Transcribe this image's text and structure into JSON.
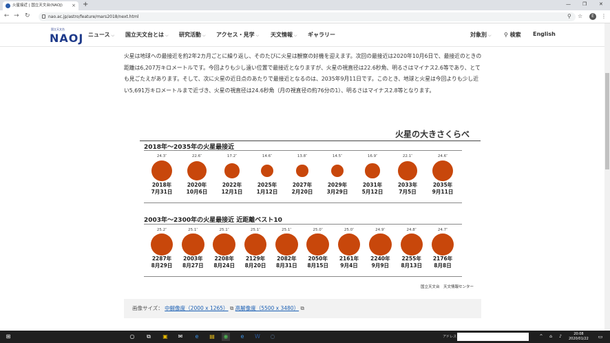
{
  "browser": {
    "tab_title": "火星接近 | 国立天文台(NAOJ)",
    "new_tab": "+",
    "url": "nao.ac.jp/astro/feature/mars2018/next.html",
    "avatar": "E",
    "window_min": "—",
    "window_max": "❐",
    "window_close": "✕"
  },
  "header": {
    "logo_small": "国立天文台",
    "logo_text": "NAOJ",
    "menu": [
      {
        "label": "ニュース",
        "chev": "⌵"
      },
      {
        "label": "国立天文台とは",
        "chev": "⌵"
      },
      {
        "label": "研究活動",
        "chev": "⌵"
      },
      {
        "label": "アクセス・見学",
        "chev": "⌵"
      },
      {
        "label": "天文情報",
        "chev": "⌵"
      },
      {
        "label": "ギャラリー",
        "chev": ""
      }
    ],
    "audience": "対象別",
    "audience_chev": "⌵",
    "search": "検索",
    "english": "English"
  },
  "article": {
    "paragraph": "火星は地球への最接近を約2年2カ月ごとに繰り返し、そのたびに火星は観察の好機を迎えます。次回の最接近は2020年10月6日で、最接近のときの距離は6,207万キロメートルです。今回よりも少し遠い位置で最接近となりますが、火星の視直径は22.6秒角、明るさはマイナス2.6等であり、とても見ごたえがあります。そして、次に火星の近日点のあたりで最接近となるのは、2035年9月11日です。このとき、地球と火星は今回よりも少し近い5,691万キロメートルまで近づき、火星の視直径は24.6秒角（月の視直径の約76分の1）、明るさはマイナス2.8等となります。"
  },
  "figure": {
    "title": "火星の大きさくらべ",
    "section1": "2018年〜2035年の火星最接近",
    "section2": "2003年〜2300年の火星最接近 近距離ベスト10",
    "credit": "国立天文台　天文情報センター",
    "row1": [
      {
        "deg": "24.3″",
        "size": 24.3,
        "year": "2018年",
        "date": "7月31日"
      },
      {
        "deg": "22.6″",
        "size": 22.6,
        "year": "2020年",
        "date": "10月6日"
      },
      {
        "deg": "17.2″",
        "size": 17.2,
        "year": "2022年",
        "date": "12月1日"
      },
      {
        "deg": "14.6″",
        "size": 14.6,
        "year": "2025年",
        "date": "1月12日"
      },
      {
        "deg": "13.8″",
        "size": 13.8,
        "year": "2027年",
        "date": "2月20日"
      },
      {
        "deg": "14.5″",
        "size": 14.5,
        "year": "2029年",
        "date": "3月29日"
      },
      {
        "deg": "16.9″",
        "size": 16.9,
        "year": "2031年",
        "date": "5月12日"
      },
      {
        "deg": "22.1″",
        "size": 22.1,
        "year": "2033年",
        "date": "7月5日"
      },
      {
        "deg": "24.6″",
        "size": 24.6,
        "year": "2035年",
        "date": "9月11日"
      }
    ],
    "row2": [
      {
        "deg": "25.2″",
        "size": 25.2,
        "year": "2287年",
        "date": "8月29日"
      },
      {
        "deg": "25.1″",
        "size": 25.1,
        "year": "2003年",
        "date": "8月27日"
      },
      {
        "deg": "25.1″",
        "size": 25.1,
        "year": "2208年",
        "date": "8月24日"
      },
      {
        "deg": "25.1″",
        "size": 25.1,
        "year": "2129年",
        "date": "8月20日"
      },
      {
        "deg": "25.1″",
        "size": 25.1,
        "year": "2082年",
        "date": "8月31日"
      },
      {
        "deg": "25.0″",
        "size": 25.0,
        "year": "2050年",
        "date": "8月15日"
      },
      {
        "deg": "25.0″",
        "size": 25.0,
        "year": "2161年",
        "date": "9月4日"
      },
      {
        "deg": "24.9″",
        "size": 24.9,
        "year": "2240年",
        "date": "9月9日"
      },
      {
        "deg": "24.8″",
        "size": 24.8,
        "year": "2255年",
        "date": "8月13日"
      },
      {
        "deg": "24.7″",
        "size": 24.7,
        "year": "2176年",
        "date": "8月8日"
      }
    ]
  },
  "image_size": {
    "label": "画像サイズ：",
    "mid": "中解像度（2000 x 1265）",
    "high": "高解像度（5500 x 3480）"
  },
  "taskbar": {
    "search_placeholder": "",
    "address_label": "アドレス",
    "time": "20:08",
    "date": "2020/01/22"
  }
}
